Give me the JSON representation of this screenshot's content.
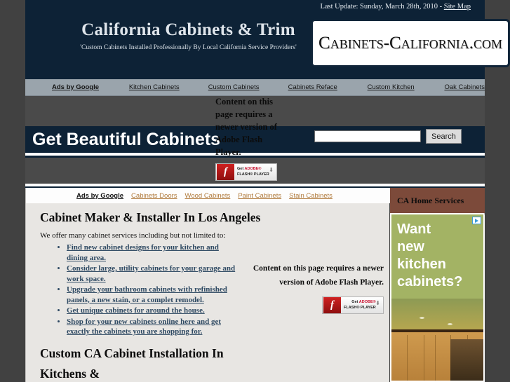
{
  "header": {
    "last_update": "Last Update: Sunday, March 28th, 2010 - ",
    "site_map_link": "Site Map",
    "brand_title": "California Cabinets & Trim",
    "brand_subtitle": "'Custom Cabinets Installed Professionally By Local California Service Providers'",
    "logo_text": "Cabinets-California.com"
  },
  "ads_nav_top": {
    "label": "Ads by Google",
    "links": [
      "Kitchen Cabinets",
      "Custom Cabinets",
      "Cabinets Reface",
      "Custom Kitchen",
      "Oak Cabinets"
    ]
  },
  "banner": {
    "headline": "Get Beautiful Cabinets"
  },
  "search": {
    "value": "",
    "placeholder": "",
    "button_label": "Search"
  },
  "flash_top": {
    "message": "Content on this page requires a newer version of Adobe Flash Player.",
    "badge_get": "Get",
    "badge_adobe": "ADOBE®",
    "badge_flash": "FLASH® PLAYER",
    "badge_icon": "flash-player-icon",
    "arrow_icon": "download-arrow-icon"
  },
  "ads_nav_main": {
    "label": "Ads by Google",
    "links": [
      "Cabinets Doors",
      "Wood Cabinets",
      "Paint Cabinets",
      "Stain Cabinets"
    ],
    "link_color": "#b07a3c"
  },
  "main": {
    "heading1": "Cabinet Maker & Installer In Los Angeles",
    "lead": "We offer many cabinet services including but not limited to:",
    "bullets": [
      "Find new cabinet designs for your kitchen and dining area.",
      "Consider large, utility cabinets for your garage and work space.",
      "Upgrade your bathroom cabinets with refinished panels, a new stain, or a complet remodel.",
      "Get unique cabinets for around the house.",
      "Shop for your new cabinets online here and get exactly the cabinets you are shopping for."
    ],
    "heading2": "Custom CA Cabinet Installation In Kitchens &",
    "flash_message": "Content on this page requires a newer version of Adobe Flash Player."
  },
  "sidebar": {
    "title": "CA Home Services",
    "ad": {
      "lines": [
        "Want",
        "new",
        "kitchen",
        "cabinets?"
      ],
      "background": "#a3b364",
      "admark_icon": "adchoices-triangle-icon",
      "photo_alt": "kitchen-cabinets-photo"
    }
  },
  "colors": {
    "navy": "#0d2236",
    "page_grey": "#414141",
    "nav_grey": "#9aa4ac",
    "sidebar_brown": "#7c4a3a",
    "content_bg": "#e8e6e3"
  }
}
